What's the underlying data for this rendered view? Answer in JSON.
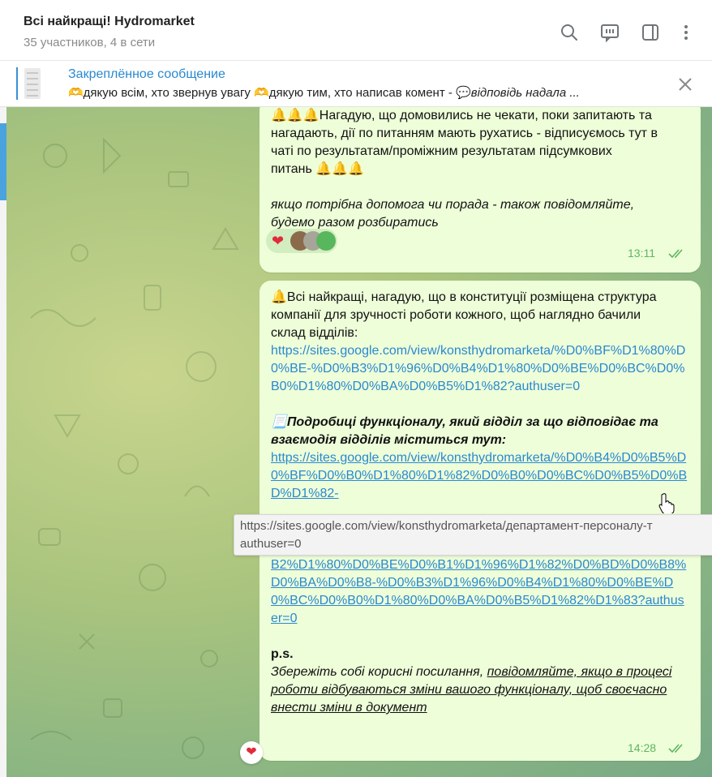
{
  "header": {
    "title": "Всі найкращі! Hydromarket",
    "subtitle": "35 участников, 4 в сети",
    "icons": [
      "search-icon",
      "comments-icon",
      "sidebar-toggle-icon",
      "more-vertical-icon"
    ]
  },
  "pinned": {
    "title": "Закреплённое сообщение",
    "text_plain": "🫶дякую всім, хто звернув увагу 🫶дякую тим, хто написав комент - 💬",
    "text_italic": "відповідь надала ..."
  },
  "messages": [
    {
      "line1": "🔔🔔🔔Нагадую, що домовились не чекати, поки запитають та",
      "line2": "нагадають, дії по питанням мають рухатись - відписуємось тут в",
      "line3": "чаті по результатам/проміжним результатам підсумкових",
      "line4": "питань 🔔🔔🔔",
      "italic1": "якщо потрібна допомога чи порада - також повідомляйте,",
      "italic2": "будемо разом розбиратись",
      "reaction": "❤",
      "time": "13:11"
    },
    {
      "line1": "🔔Всі найкращі, нагадую, що в конституції розміщена структура",
      "line2": "компанії для зручності роботи кожного, щоб наглядно бачили",
      "line3": "склад відділів:",
      "link1": "https://sites.google.com/view/konsthydromarketa/%D0%BF%D1%80%D0%BE-%D0%B3%D1%96%D0%B4%D1%80%D0%BE%D0%BC%D0%B0%D1%80%D0%BA%D0%B5%D1%82?authuser=0",
      "bold1": "📃Подробиці функціоналу, який відділ за що відповідає та",
      "bold2": "взаємодія відділів міститься тут:",
      "link2a": "https://sites.google.com/view/konsthydromarketa/%D0%B4%D0%B5%D0%BF%D0%B0%D1%80%D1%82%D0%B0%D0%BC%D0%B5%D0%BD%D1%82-",
      "link2b": "%D1%84%D1%83%D0%BD%D0%BA%D1%86%D1%96%D0%BE%D0%BD%D0%B0%D0%BB%D1%83/%D1%81%D0%BF%D1%96%D0%B2%D1%80%D0%BE%D0%B1%D1%96%D1%82%D0%BD%D0%B8%D0%BA%D0%B8-%D0%B3%D1%96%D0%B4%D1%80%D0%BE%D0%BC%D0%B0%D1%80%D0%BA%D0%B5%D1%82%D1%83?authuser=0",
      "ps": "p.s.",
      "ps_italic": "Збережіть собі корисні посилання, ",
      "ps_underline1": "повідомляйте, якщо в процесі",
      "ps_underline2": "роботи відбуваються зміни вашого функціоналу, щоб своєчасно",
      "ps_underline3": "внести зміни в документ",
      "time": "14:28"
    }
  ],
  "tooltip": {
    "line1": "https://sites.google.com/view/konsthydromarketa/департамент-персоналу-т",
    "line2": "authuser=0"
  },
  "floating_reaction": "❤",
  "colors": {
    "accent": "#2a88d0",
    "bubble": "#eefed9",
    "time": "#5fb561"
  }
}
